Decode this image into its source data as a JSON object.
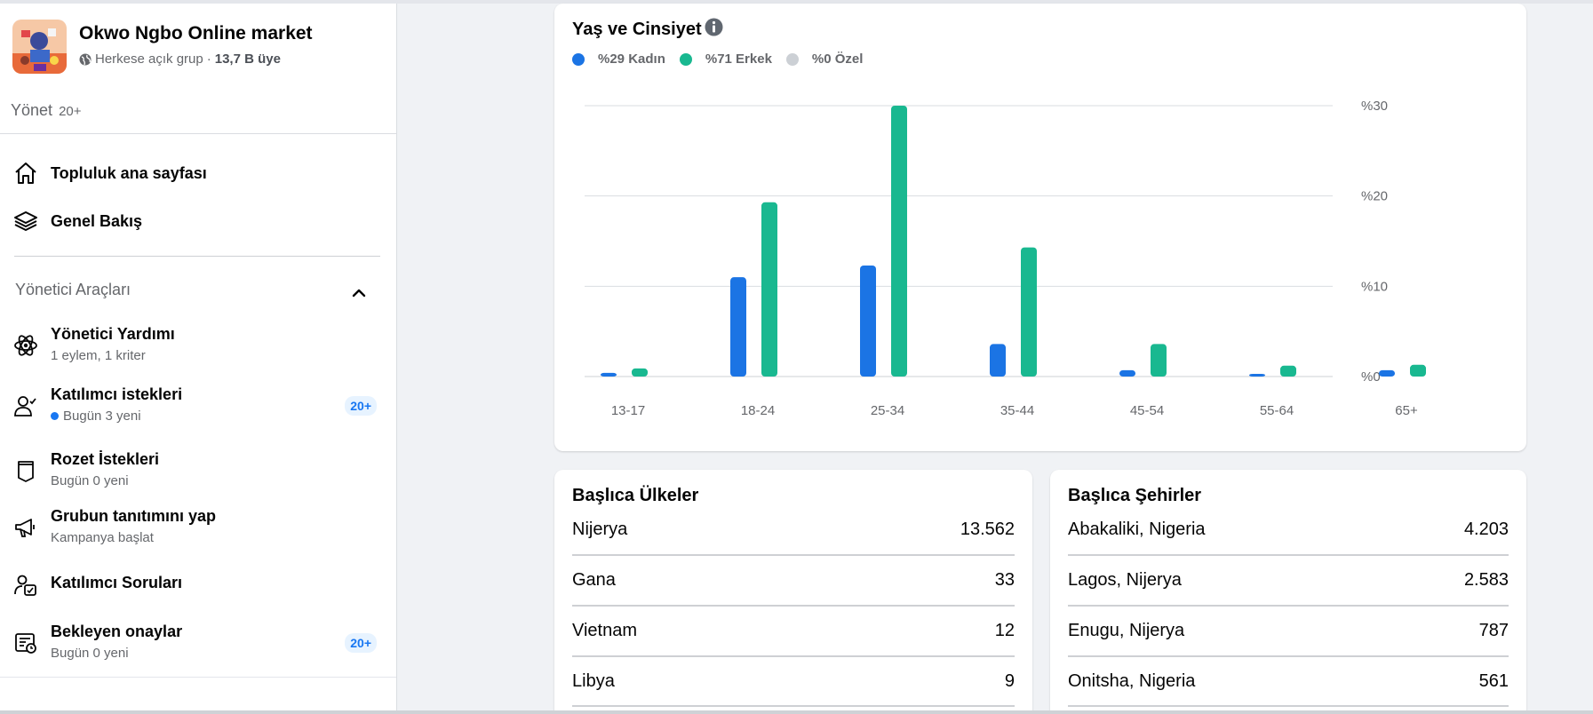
{
  "group": {
    "name": "Okwo Ngbo Online market",
    "privacy": "Herkese açık grup",
    "separator": "·",
    "members": "13,7 B üye"
  },
  "manage": {
    "label": "Yönet",
    "count": "20+"
  },
  "nav": [
    {
      "label": "Topluluk ana sayfası",
      "icon": "home-icon"
    },
    {
      "label": "Genel Bakış",
      "icon": "layers-icon"
    }
  ],
  "admin_tools": {
    "title": "Yönetici Araçları",
    "items": [
      {
        "title": "Yönetici Yardımı",
        "sub": "1 eylem, 1 kriter",
        "icon": "admin-assist-icon",
        "badge": ""
      },
      {
        "title": "Katılımcı istekleri",
        "sub": "Bugün 3 yeni",
        "icon": "member-requests-icon",
        "badge": "20+",
        "dot": true
      },
      {
        "title": "Rozet İstekleri",
        "sub": "Bugün 0 yeni",
        "icon": "badge-icon",
        "badge": ""
      },
      {
        "title": "Grubun tanıtımını yap",
        "sub": "Kampanya başlat",
        "icon": "megaphone-icon",
        "badge": ""
      },
      {
        "title": "Katılımcı Soruları",
        "sub": "",
        "icon": "member-questions-icon",
        "badge": ""
      },
      {
        "title": "Bekleyen onaylar",
        "sub": "Bugün 0 yeni",
        "icon": "pending-approvals-icon",
        "badge": "20+"
      }
    ]
  },
  "age_gender": {
    "title": "Yaş ve Cinsiyet",
    "legend": [
      {
        "label": "%29 Kadın",
        "color": "#1b74e4"
      },
      {
        "label": "%71 Erkek",
        "color": "#19b890"
      },
      {
        "label": "%0 Özel",
        "color": "#ccd0d5"
      }
    ]
  },
  "chart_data": {
    "type": "bar",
    "title": "Yaş ve Cinsiyet",
    "categories": [
      "13-17",
      "18-24",
      "25-34",
      "35-44",
      "45-54",
      "55-64",
      "65+"
    ],
    "series": [
      {
        "name": "Kadın",
        "color": "#1b74e4",
        "values": [
          0.4,
          11,
          12.3,
          3.6,
          0.7,
          0.3,
          0.7
        ]
      },
      {
        "name": "Erkek",
        "color": "#19b890",
        "values": [
          0.9,
          19.3,
          30,
          14.3,
          3.6,
          1.2,
          1.3
        ]
      }
    ],
    "ylim": [
      0,
      30
    ],
    "yticks": [
      "%0",
      "%10",
      "%20",
      "%30"
    ],
    "ytick_values": [
      0,
      10,
      20,
      30
    ],
    "grid": true,
    "legend_position": "top-left"
  },
  "countries": {
    "title": "Başlıca Ülkeler",
    "rows": [
      {
        "name": "Nijerya",
        "value": "13.562"
      },
      {
        "name": "Gana",
        "value": "33"
      },
      {
        "name": "Vietnam",
        "value": "12"
      },
      {
        "name": "Libya",
        "value": "9"
      }
    ]
  },
  "cities": {
    "title": "Başlıca Şehirler",
    "rows": [
      {
        "name": "Abakaliki, Nigeria",
        "value": "4.203"
      },
      {
        "name": "Lagos, Nijerya",
        "value": "2.583"
      },
      {
        "name": "Enugu, Nijerya",
        "value": "787"
      },
      {
        "name": "Onitsha, Nigeria",
        "value": "561"
      }
    ]
  }
}
